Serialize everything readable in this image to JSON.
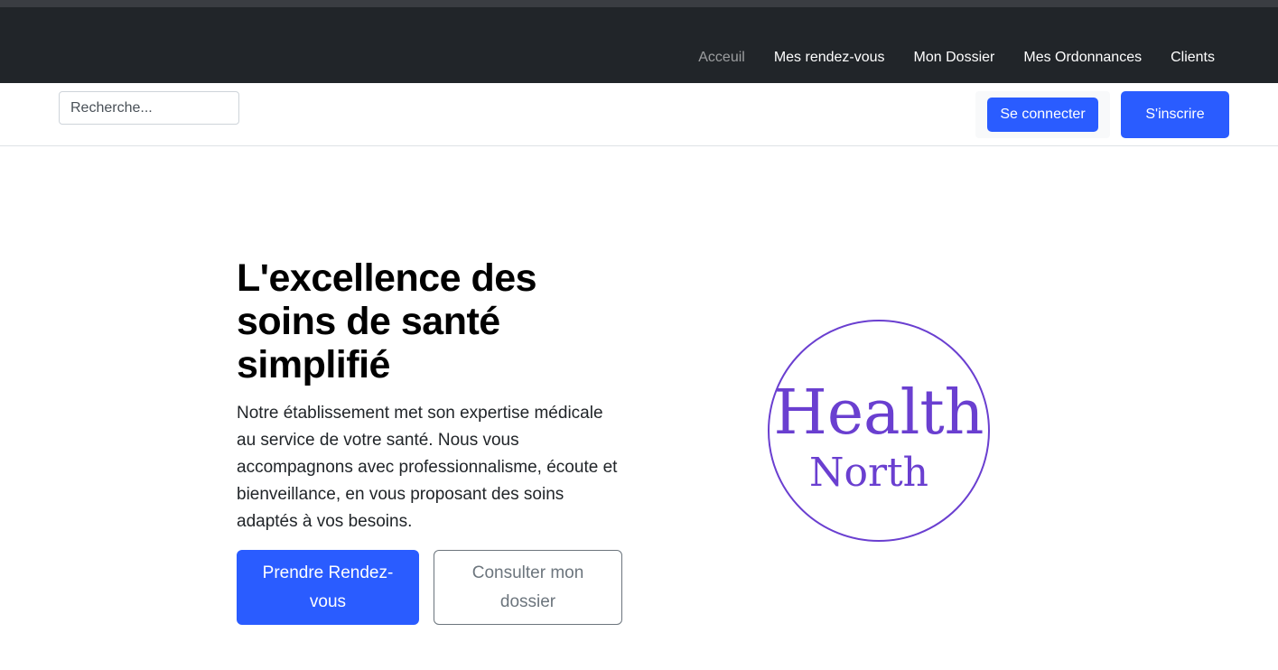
{
  "nav": {
    "links": [
      "Acceuil",
      "Mes rendez-vous",
      "Mon Dossier",
      "Mes Ordonnances",
      "Clients"
    ],
    "active": "Acceuil"
  },
  "subbar": {
    "search_placeholder": "Recherche...",
    "login_label": "Se connecter",
    "signup_label": "S'inscrire"
  },
  "hero": {
    "title": "L'excellence des soins de santé simplifié",
    "text": "Notre établissement met son expertise médicale au service de votre santé. Nous vous accompagnons avec professionnalisme, écoute et bienveillance, en vous proposant des soins adaptés à vos besoins.",
    "primary_label": "Prendre Rendez-vous",
    "secondary_label": "Consulter mon dossier"
  },
  "logo": {
    "line1": "Health",
    "line2": "North",
    "color": "#6a3fd0"
  },
  "colors": {
    "navbar_bg": "#212529",
    "accent": "#2a5cff"
  }
}
